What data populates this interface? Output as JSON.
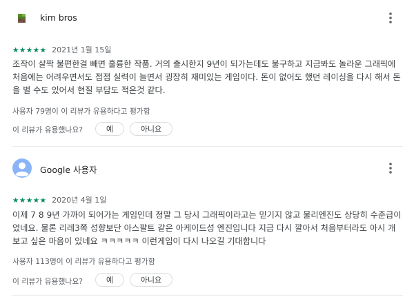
{
  "reviews": [
    {
      "name": "kim bros",
      "stars": "★★★★★",
      "rating": 5,
      "date": "2021년 1월 15일",
      "text": "조작이 살짝 불편한걸 빼면 훌륭한 작품. 거의 출시한지 9년이 되가는데도 불구하고 지금봐도 놀라운 그래픽에 처음에는 어려우면서도 점점 실력이 늘면서 굉장히 재미있는 게임이다. 돈이 없어도 했던 레이싱을 다시 해서 돈을 벌 수도 있어서 현질 부담도 적은것 같다.",
      "helpful": "사용자 79명이 이 리뷰가 유용하다고 평가함",
      "question": "이 리뷰가 유용했나요?",
      "yes": "예",
      "no": "아니요"
    },
    {
      "name": "Google 사용자",
      "stars": "★★★★★",
      "rating": 5,
      "date": "2020년 4월 1일",
      "text": "이제 7 8 9년 가까이 되어가는 게임인데 정말 그 당시 그래픽이라고는 믿기지 않고 물리엔진도 상당히 수준급이었네요. 물론 리레3쪽 성향보단 아스팔트 같은 아케이드성 엔진입니다 지금 다시 깔아서 처음부터라도 아시 개보고 싶은 마음이 있네요 ㅋㅋㅋㅋㅋ 이런게임이 다시 나오길 기대합니다",
      "helpful": "사용자 113명이 이 리뷰가 유용하다고 평가함",
      "question": "이 리뷰가 유용했나요?",
      "yes": "예",
      "no": "아니요"
    }
  ],
  "colors": {
    "star": "#01875f",
    "avatar_blue": "#8ab4f8"
  },
  "icons": [
    "pixel-avatar-icon",
    "user-avatar-icon",
    "more-vert-icon"
  ]
}
